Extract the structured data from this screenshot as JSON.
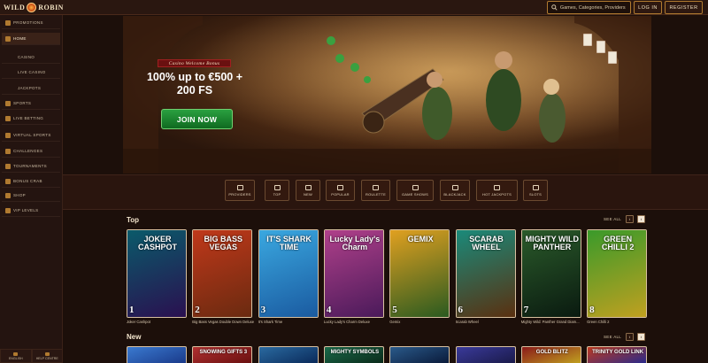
{
  "header": {
    "logo_text": "WILD ROBIN",
    "search_placeholder": "Games, Categories, Providers",
    "login_label": "LOG IN",
    "register_label": "REGISTER"
  },
  "sidebar": {
    "items": [
      {
        "label": "PROMOTIONS",
        "icon": "gift-icon"
      },
      {
        "label": "HOME",
        "icon": "home-icon",
        "active": true
      },
      {
        "label": "CASINO",
        "sub": true
      },
      {
        "label": "LIVE CASINO",
        "sub": true
      },
      {
        "label": "JACKPOTS",
        "sub": true
      },
      {
        "label": "SPORTS",
        "icon": "ball-icon"
      },
      {
        "label": "LIVE BETTING",
        "icon": "live-icon"
      },
      {
        "label": "VIRTUAL SPORTS",
        "icon": "virtual-icon"
      },
      {
        "label": "CHALLENGES",
        "icon": "target-icon"
      },
      {
        "label": "TOURNAMENTS",
        "icon": "trophy-icon"
      },
      {
        "label": "BONUS CRAB",
        "icon": "crab-icon"
      },
      {
        "label": "SHOP",
        "icon": "cart-icon"
      },
      {
        "label": "VIP LEVELS",
        "icon": "crown-icon"
      }
    ],
    "language_label": "ENGLISH",
    "help_label": "HELP CENTRE"
  },
  "hero": {
    "tag": "Casino Welcome Bonus",
    "title": "100% up to €500 + 200 FS",
    "cta": "JOIN NOW"
  },
  "categories": [
    {
      "label": "PROVIDERS",
      "icon": "providers-icon"
    },
    {
      "label": "TOP",
      "icon": "top-icon"
    },
    {
      "label": "NEW",
      "icon": "new-icon"
    },
    {
      "label": "POPULAR",
      "icon": "popular-icon"
    },
    {
      "label": "ROULETTE",
      "icon": "roulette-icon"
    },
    {
      "label": "GAME SHOWS",
      "icon": "gameshow-icon"
    },
    {
      "label": "BLACKJACK",
      "icon": "blackjack-icon"
    },
    {
      "label": "HOT JACKPOTS",
      "icon": "jackpot-icon"
    },
    {
      "label": "SLOTS",
      "icon": "slots-icon"
    }
  ],
  "sections": {
    "top": {
      "title": "Top",
      "see_all": "SEE ALL"
    },
    "new": {
      "title": "New",
      "see_all": "SEE ALL"
    }
  },
  "top_games": [
    {
      "rank": "1",
      "name": "Joker Cashpot",
      "art_text": "JOKER CASHPOT",
      "colors": [
        "#0a5a6a",
        "#2a1050"
      ]
    },
    {
      "rank": "2",
      "name": "Big Bass Vegas Double Down Deluxe",
      "art_text": "BIG BASS VEGAS",
      "colors": [
        "#c0381a",
        "#6a2a10"
      ]
    },
    {
      "rank": "3",
      "name": "It's Shark Time",
      "art_text": "IT'S SHARK TIME",
      "colors": [
        "#3aa8e0",
        "#1a5aa0"
      ]
    },
    {
      "rank": "4",
      "name": "Lucky Lady's Charm Deluxe",
      "art_text": "Lucky Lady's Charm",
      "colors": [
        "#b0408a",
        "#4a1a5a"
      ]
    },
    {
      "rank": "5",
      "name": "Gemix",
      "art_text": "GEMIX",
      "colors": [
        "#e0a020",
        "#2a5a20"
      ]
    },
    {
      "rank": "6",
      "name": "Scarab Wheel",
      "art_text": "SCARAB WHEEL",
      "colors": [
        "#1a8a7a",
        "#5a3010"
      ]
    },
    {
      "rank": "7",
      "name": "Mighty Wild: Panther Grand Diam...",
      "art_text": "MIGHTY WILD PANTHER",
      "colors": [
        "#2a5a2a",
        "#0a1a10"
      ]
    },
    {
      "rank": "8",
      "name": "Green Chilli 2",
      "art_text": "GREEN CHILLI 2",
      "colors": [
        "#3a9a2a",
        "#c0a020"
      ]
    }
  ],
  "new_games": [
    {
      "art_text": "",
      "colors": [
        "#3a7ad0",
        "#1a3a8a"
      ]
    },
    {
      "art_text": "SNOWING GIFTS 3",
      "colors": [
        "#b03030",
        "#6a1010"
      ]
    },
    {
      "art_text": "",
      "colors": [
        "#2a6aa0",
        "#0a2a5a"
      ]
    },
    {
      "art_text": "MIGHTY SYMBOLS",
      "colors": [
        "#1a6a4a",
        "#0a2a1a"
      ]
    },
    {
      "art_text": "",
      "colors": [
        "#2a5a8a",
        "#0a1a3a"
      ]
    },
    {
      "art_text": "",
      "colors": [
        "#3a3a9a",
        "#1a1a4a"
      ]
    },
    {
      "art_text": "GOLD BLITZ",
      "colors": [
        "#8a1a1a",
        "#c0a020"
      ]
    },
    {
      "art_text": "TRINITY GOLD LINK",
      "colors": [
        "#c03a20",
        "#2a2a8a"
      ]
    }
  ]
}
